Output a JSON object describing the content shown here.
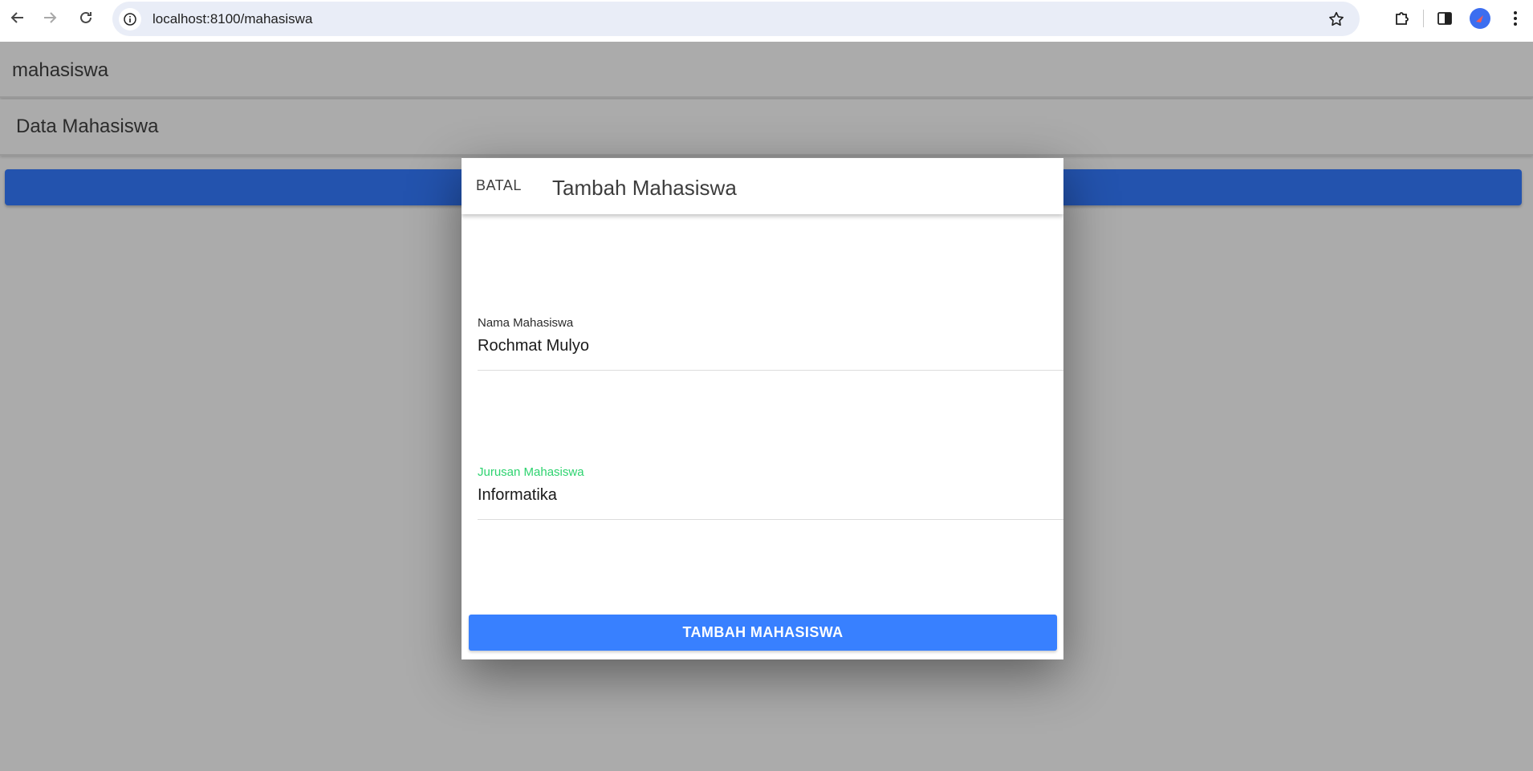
{
  "browser": {
    "url": "localhost:8100/mahasiswa"
  },
  "app": {
    "toolbar_title": "mahasiswa",
    "content_title": "Data Mahasiswa"
  },
  "modal": {
    "cancel_label": "BATAL",
    "title": "Tambah Mahasiswa",
    "fields": [
      {
        "label": "Nama Mahasiswa",
        "value": "Rochmat Mulyo"
      },
      {
        "label": "Jurusan Mahasiswa",
        "value": "Informatika"
      }
    ],
    "submit_label": "TAMBAH MAHASISWA"
  },
  "colors": {
    "primary": "#3880ff",
    "success": "#2dd36f",
    "backdrop": "#ababab"
  }
}
